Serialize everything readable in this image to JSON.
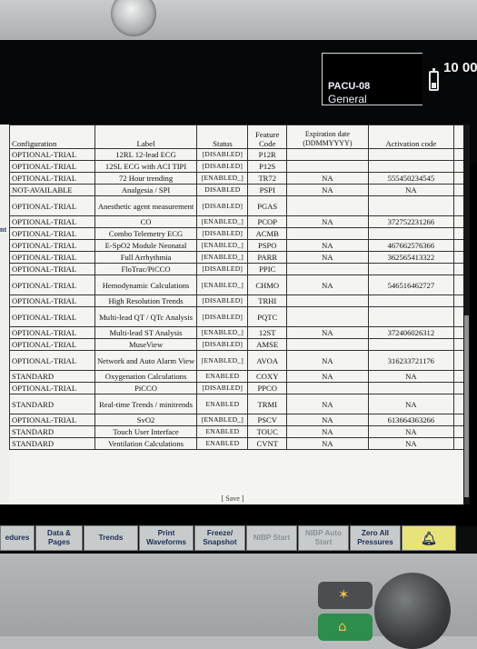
{
  "monitor": {
    "unit_name": "PACU-08",
    "profile": "General",
    "clock": "10 00"
  },
  "side_label": "nt",
  "table": {
    "headers": [
      "Configuration",
      "Label",
      "Status",
      "Feature Code",
      "Expiration date (DDMMYYYY)",
      "Activation code"
    ],
    "rows": [
      [
        "OPTIONAL-TRIAL",
        "12RL 12-lead ECG",
        "[DISABLED]",
        "P12R",
        "",
        ""
      ],
      [
        "OPTIONAL-TRIAL",
        "12SL ECG with ACI TIPI",
        "[DISABLED]",
        "P12S",
        "",
        ""
      ],
      [
        "OPTIONAL-TRIAL",
        "72 Hour trending",
        "[ENABLED_]",
        "TR72",
        "NA",
        "555450234545"
      ],
      [
        "NOT-AVAILABLE",
        "Analgesia / SPI",
        "DISABLED",
        "PSPI",
        "NA",
        "NA"
      ],
      [
        "OPTIONAL-TRIAL",
        "Anesthetic agent measurement",
        "[DISABLED]",
        "PGAS",
        "",
        ""
      ],
      [
        "OPTIONAL-TRIAL",
        "CO",
        "[ENABLED_]",
        "PCOP",
        "NA",
        "372752231266"
      ],
      [
        "OPTIONAL-TRIAL",
        "Combo Telemetry ECG",
        "[DISABLED]",
        "ACMB",
        "",
        ""
      ],
      [
        "OPTIONAL-TRIAL",
        "E-SpO2 Module Neonatal",
        "[ENABLED_]",
        "PSPO",
        "NA",
        "467662576366"
      ],
      [
        "OPTIONAL-TRIAL",
        "Full Arrhythmia",
        "[ENABLED_]",
        "PARR",
        "NA",
        "362565413322"
      ],
      [
        "OPTIONAL-TRIAL",
        "FloTrac/PiCCO",
        "[DISABLED]",
        "PPIC",
        "",
        ""
      ],
      [
        "OPTIONAL-TRIAL",
        "Hemodynamic Calculations",
        "[ENABLED_]",
        "CHMO",
        "NA",
        "546516462727"
      ],
      [
        "OPTIONAL-TRIAL",
        "High Resolution Trends",
        "[DISABLED]",
        "TRHI",
        "",
        ""
      ],
      [
        "OPTIONAL-TRIAL",
        "Multi-lead QT / QTc Analysis",
        "[DISABLED]",
        "PQTC",
        "",
        ""
      ],
      [
        "OPTIONAL-TRIAL",
        "Multi-lead ST Analysis",
        "[ENABLED_]",
        "12ST",
        "NA",
        "372406026312"
      ],
      [
        "OPTIONAL-TRIAL",
        "MuseView",
        "[DISABLED]",
        "AMSE",
        "",
        ""
      ],
      [
        "OPTIONAL-TRIAL",
        "Network and Auto Alarm View",
        "[ENABLED_]",
        "AVOA",
        "NA",
        "316233721176"
      ],
      [
        "STANDARD",
        "Oxygenation Calculations",
        "ENABLED",
        "COXY",
        "NA",
        "NA"
      ],
      [
        "OPTIONAL-TRIAL",
        "PiCCO",
        "[DISABLED]",
        "PPCO",
        "",
        ""
      ],
      [
        "STANDARD",
        "Real-time Trends / minitrends",
        "ENABLED",
        "TRMI",
        "NA",
        "NA"
      ],
      [
        "OPTIONAL-TRIAL",
        "SvO2",
        "[ENABLED_]",
        "PSCV",
        "NA",
        "613664363266"
      ],
      [
        "STANDARD",
        "Touch User Interface",
        "ENABLED",
        "TOUC",
        "NA",
        "NA"
      ],
      [
        "STANDARD",
        "Ventilation Calculations",
        "ENABLED",
        "CVNT",
        "NA",
        "NA"
      ]
    ],
    "save_label": "[ Save ]"
  },
  "buttons": [
    {
      "label": "edures"
    },
    {
      "label": "Data & Pages"
    },
    {
      "label": "Trends"
    },
    {
      "label": "Print Waveforms"
    },
    {
      "label": "Freeze/ Snapshot"
    },
    {
      "label": "NIBP Start"
    },
    {
      "label": "NIBP Auto Start"
    },
    {
      "label": "Zero All Pressures"
    },
    {
      "label": "alarm-bell-icon"
    }
  ],
  "colors": {
    "panel_bg": "#f4f5f2",
    "button_bg": "#c7cbcc",
    "button_text": "#1e2f55",
    "alarm_button_bg": "#e8e27a",
    "screen_bg": "#000000"
  }
}
